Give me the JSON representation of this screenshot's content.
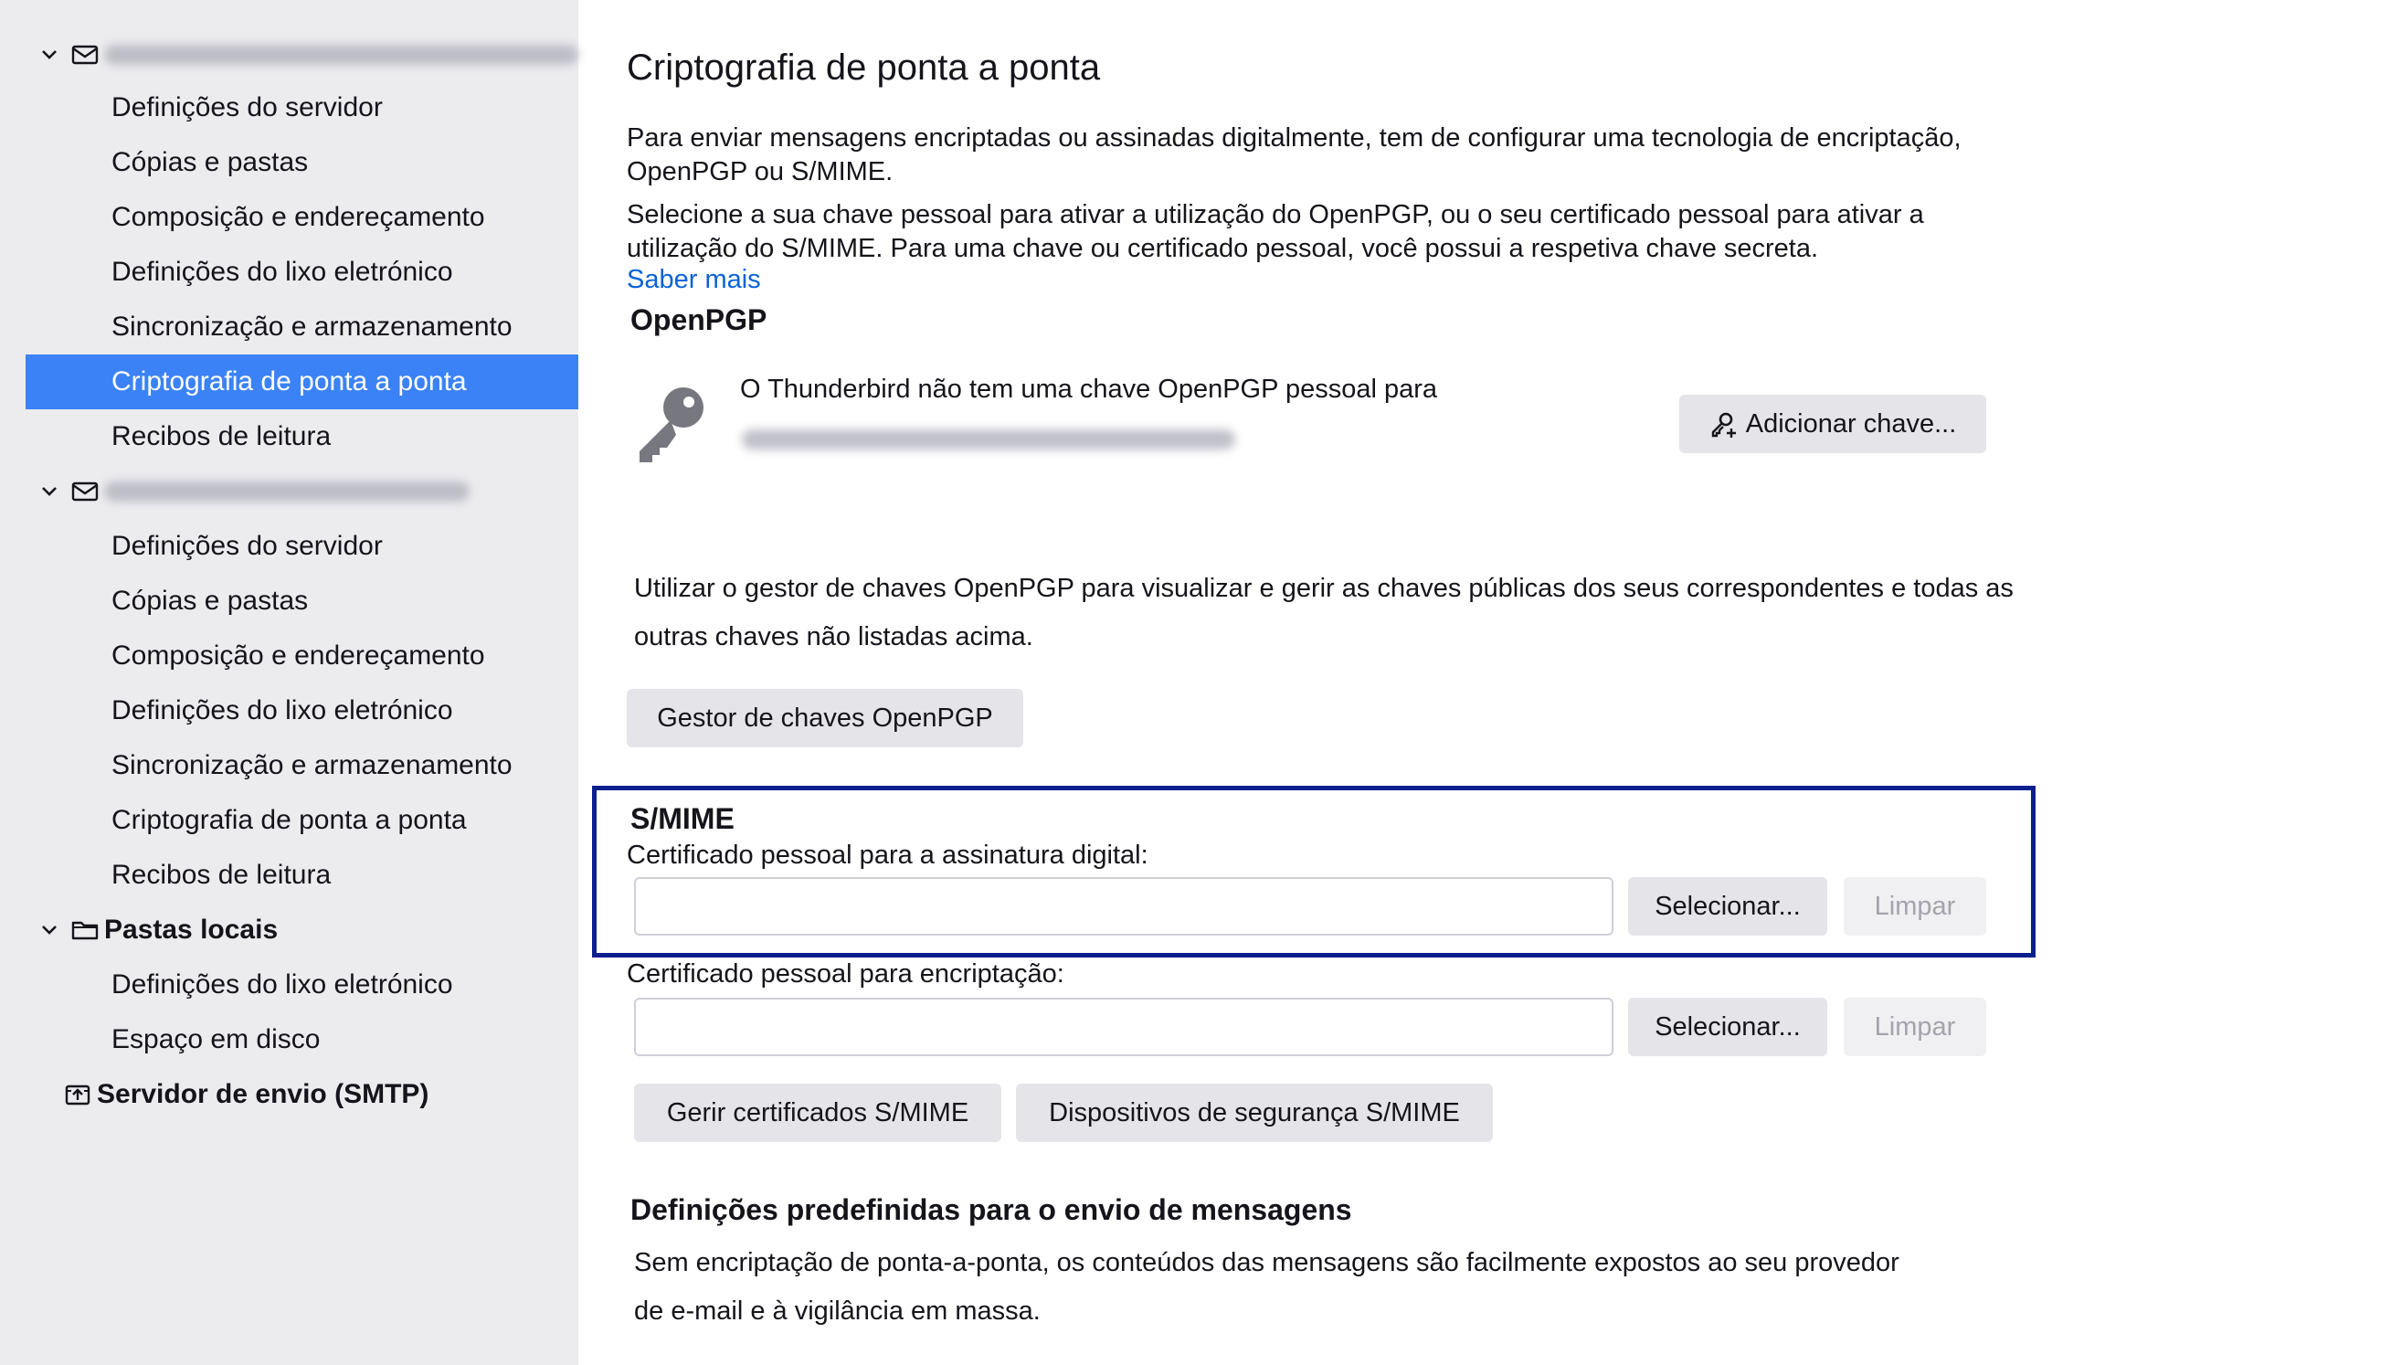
{
  "sidebar": {
    "account1": {
      "email": "",
      "items": [
        "Definições do servidor",
        "Cópias e pastas",
        "Composição e endereçamento",
        "Definições do lixo eletrónico",
        "Sincronização e armazenamento",
        "Criptografia de ponta a ponta",
        "Recibos de leitura"
      ],
      "selected_index": 5
    },
    "account2": {
      "email": "",
      "items": [
        "Definições do servidor",
        "Cópias e pastas",
        "Composição e endereçamento",
        "Definições do lixo eletrónico",
        "Sincronização e armazenamento",
        "Criptografia de ponta a ponta",
        "Recibos de leitura"
      ]
    },
    "local_folders": {
      "label": "Pastas locais",
      "items": [
        "Definições do lixo eletrónico",
        "Espaço em disco"
      ]
    },
    "smtp": {
      "label": "Servidor de envio (SMTP)"
    }
  },
  "main": {
    "title": "Criptografia de ponta a ponta",
    "intro1": "Para enviar mensagens encriptadas ou assinadas digitalmente, tem de configurar uma tecnologia de encriptação, OpenPGP ou S/MIME.",
    "intro2": "Selecione a sua chave pessoal para ativar a utilização do OpenPGP, ou o seu certificado pessoal para ativar a utilização do S/MIME. Para uma chave ou certificado pessoal, você possui a respetiva chave secreta.",
    "learn_more": "Saber mais",
    "openpgp": {
      "heading": "OpenPGP",
      "no_key_text": "O Thunderbird não tem uma chave OpenPGP pessoal para",
      "add_key_button": "Adicionar chave...",
      "manager_text": "Utilizar o gestor de chaves OpenPGP para visualizar e gerir as chaves públicas dos seus correspondentes e todas as outras chaves não listadas acima.",
      "manager_button": "Gestor de chaves OpenPGP"
    },
    "smime": {
      "heading": "S/MIME",
      "signing_label": "Certificado pessoal para a assinatura digital:",
      "signing_value": "",
      "encryption_label": "Certificado pessoal para encriptação:",
      "encryption_value": "",
      "select_button": "Selecionar...",
      "clear_button": "Limpar",
      "manage_certs_button": "Gerir certificados S/MIME",
      "security_devices_button": "Dispositivos de segurança S/MIME"
    },
    "defaults": {
      "heading": "Definições predefinidas para o envio de mensagens",
      "text": "Sem encriptação de ponta-a-ponta, os conteúdos das mensagens são facilmente expostos ao seu provedor de e-mail e à vigilância em massa."
    }
  },
  "colors": {
    "selected_bg": "#3b82f6",
    "link": "#0b62d6",
    "highlight_border": "#0d1f8f",
    "sidebar_bg": "#ececef"
  }
}
